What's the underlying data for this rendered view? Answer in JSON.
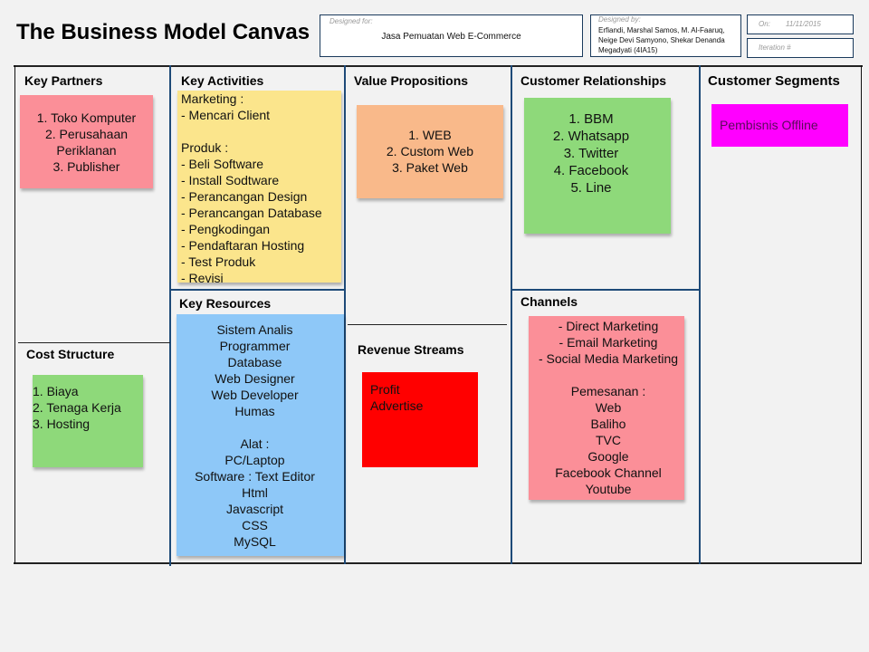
{
  "header": {
    "title": "The Business Model Canvas",
    "designed_for": {
      "label": "Designed for:",
      "value": "Jasa Pemuatan Web E-Commerce"
    },
    "designed_by": {
      "label": "Designed by:",
      "lines": [
        "Erfiandi, Marshal Samos, M. Al-Faaruq,",
        "Neige Devi Samyono, Shekar Denanda",
        "Megadyati (4IA15)"
      ]
    },
    "on": {
      "label": "On:",
      "value": "11/11/2015"
    },
    "iteration": {
      "label": "Iteration #",
      "value": ""
    }
  },
  "sections": {
    "key_partners": {
      "title": "Key Partners",
      "note_color": "#fb8f98",
      "lines": [
        "1. Toko Komputer",
        "2. Perusahaan",
        "Periklanan",
        "3. Publisher"
      ]
    },
    "key_activities": {
      "title": "Key Activities",
      "note_color": "#fbe58c",
      "lines": [
        "Marketing :",
        "- Mencari Client",
        "",
        "Produk :",
        "- Beli Software",
        "- Install Sodtware",
        "- Perancangan Design",
        "- Perancangan Database",
        "- Pengkodingan",
        "- Pendaftaran Hosting",
        "- Test Produk",
        "- Revisi"
      ]
    },
    "key_resources": {
      "title": "Key Resources",
      "note_color": "#8ec8f8",
      "lines": [
        "Sistem Analis",
        "Programmer",
        "Database",
        "Web Designer",
        "Web Developer",
        "Humas",
        "",
        "Alat :",
        "PC/Laptop",
        "Software : Text Editor",
        "Html",
        "Javascript",
        "CSS",
        "MySQL"
      ]
    },
    "value_propositions": {
      "title": "Value Propositions",
      "note_color": "#f9b98a",
      "lines": [
        "1. WEB",
        "2. Custom Web",
        "3. Paket Web"
      ]
    },
    "customer_relationships": {
      "title": "Customer Relationships",
      "note_color": "#8ed97a",
      "lines": [
        "1. BBM",
        "2. Whatsapp",
        "3. Twitter",
        "4. Facebook",
        "5. Line"
      ]
    },
    "channels": {
      "title": "Channels",
      "note_color": "#fb8f98",
      "lines": [
        "- Direct Marketing",
        "- Email Marketing",
        "- Social Media Marketing",
        "",
        "Pemesanan :",
        "Web",
        "Baliho",
        "TVC",
        "Google",
        "Facebook Channel",
        "Youtube"
      ]
    },
    "customer_segments": {
      "title": "Customer Segments",
      "note_color": "#ff00ff",
      "lines": [
        "Pembisnis Offline"
      ]
    },
    "cost_structure": {
      "title": "Cost Structure",
      "note_color": "#8ed97a",
      "lines": [
        "1. Biaya",
        "2. Tenaga Kerja",
        "3. Hosting"
      ]
    },
    "revenue_streams": {
      "title": "Revenue Streams",
      "note_color": "#ff0000",
      "lines": [
        "Profit",
        "Advertise"
      ]
    }
  }
}
